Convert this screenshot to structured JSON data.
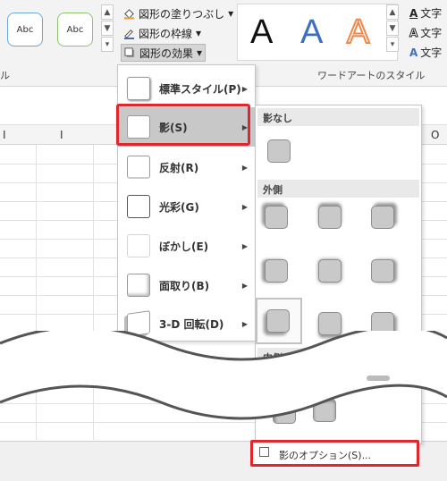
{
  "ribbon": {
    "shape_styles": [
      "Abc",
      "Abc"
    ],
    "commands": {
      "fill": "図形の塗りつぶし",
      "outline": "図形の枠線",
      "effects": "図形の効果"
    },
    "group_left_label": "ル",
    "wordart": {
      "letters": [
        "A",
        "A",
        "A"
      ],
      "group_label": "ワードアートのスタイル"
    },
    "text_commands": [
      "文字",
      "文字",
      "文字"
    ]
  },
  "sheet": {
    "col_left": "I",
    "col_left2": "I",
    "col_right": "O"
  },
  "effects_menu": {
    "items": [
      {
        "label": "標準スタイル(P)"
      },
      {
        "label": "影(S)"
      },
      {
        "label": "反射(R)"
      },
      {
        "label": "光彩(G)"
      },
      {
        "label": "ぼかし(E)"
      },
      {
        "label": "面取り(B)"
      },
      {
        "label": "3-D 回転(D)"
      }
    ]
  },
  "shadow_submenu": {
    "no_shadow": "影なし",
    "outer": "外側",
    "inner": "内側",
    "options": "影のオプション(S)..."
  },
  "colors": {
    "highlight": "#e0262e",
    "wordart_blue": "#3a6fc4",
    "wordart_orange": "#f0884a"
  }
}
